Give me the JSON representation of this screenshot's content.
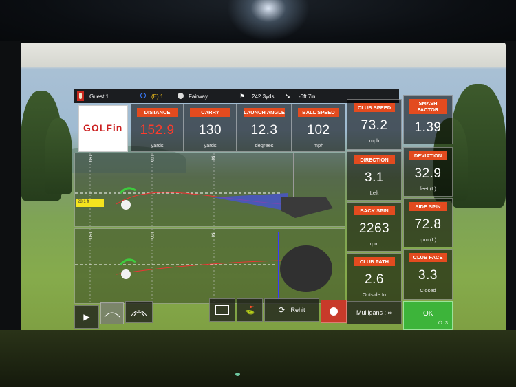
{
  "player": {
    "name": "Guest.1"
  },
  "hole_bar": {
    "score": "(E) 1",
    "lie": "Fairway",
    "distance": "242.3yds",
    "pin_offset": "-6ft 7in"
  },
  "logo": {
    "text": "GOLFin"
  },
  "stats_row": [
    {
      "label": "DISTANCE",
      "value": "152.9",
      "unit": "yards",
      "highlight": true
    },
    {
      "label": "CARRY",
      "value": "130",
      "unit": "yards"
    },
    {
      "label": "LAUNCH ANGLE",
      "value": "12.3",
      "unit": "degrees"
    },
    {
      "label": "BALL SPEED",
      "value": "102",
      "unit": "mph"
    }
  ],
  "club_stats": [
    {
      "label": "CLUB SPEED",
      "value": "73.2",
      "unit": "mph"
    },
    {
      "label": "SMASH FACTOR",
      "value": "1.39",
      "unit": ""
    },
    {
      "label": "DIRECTION",
      "value": "3.1",
      "unit": "Left"
    },
    {
      "label": "DEVIATION",
      "value": "32.9",
      "unit": "feet (L)"
    },
    {
      "label": "BACK SPIN",
      "value": "2263",
      "unit": "rpm"
    },
    {
      "label": "SIDE SPIN",
      "value": "72.8",
      "unit": "rpm (L)"
    },
    {
      "label": "CLUB PATH",
      "value": "2.6",
      "unit": "Outside In"
    },
    {
      "label": "CLUB FACE",
      "value": "3.3",
      "unit": "Closed"
    }
  ],
  "side_view": {
    "marks": [
      "150",
      "100",
      "50"
    ],
    "flag_label": "28.1 ft"
  },
  "top_view": {
    "marks": [
      "150",
      "100",
      "50"
    ]
  },
  "toolbar": {
    "rehit": "Rehit",
    "mulligans": "Mulligans : ∞",
    "ok": "OK",
    "ok_count": "3"
  },
  "colors": {
    "accent": "#e34b1f",
    "highlight_value": "#ff3b2b",
    "ok_green": "#3db43a"
  },
  "icons": [
    "golfer-icon",
    "circle-icon",
    "ball-icon",
    "flag-icon",
    "arrow-down-right-icon",
    "play-icon",
    "trajectory-low-icon",
    "trajectory-high-icon",
    "video-icon",
    "swing-icon",
    "refresh-icon",
    "mulligan-icon",
    "power-icon"
  ]
}
